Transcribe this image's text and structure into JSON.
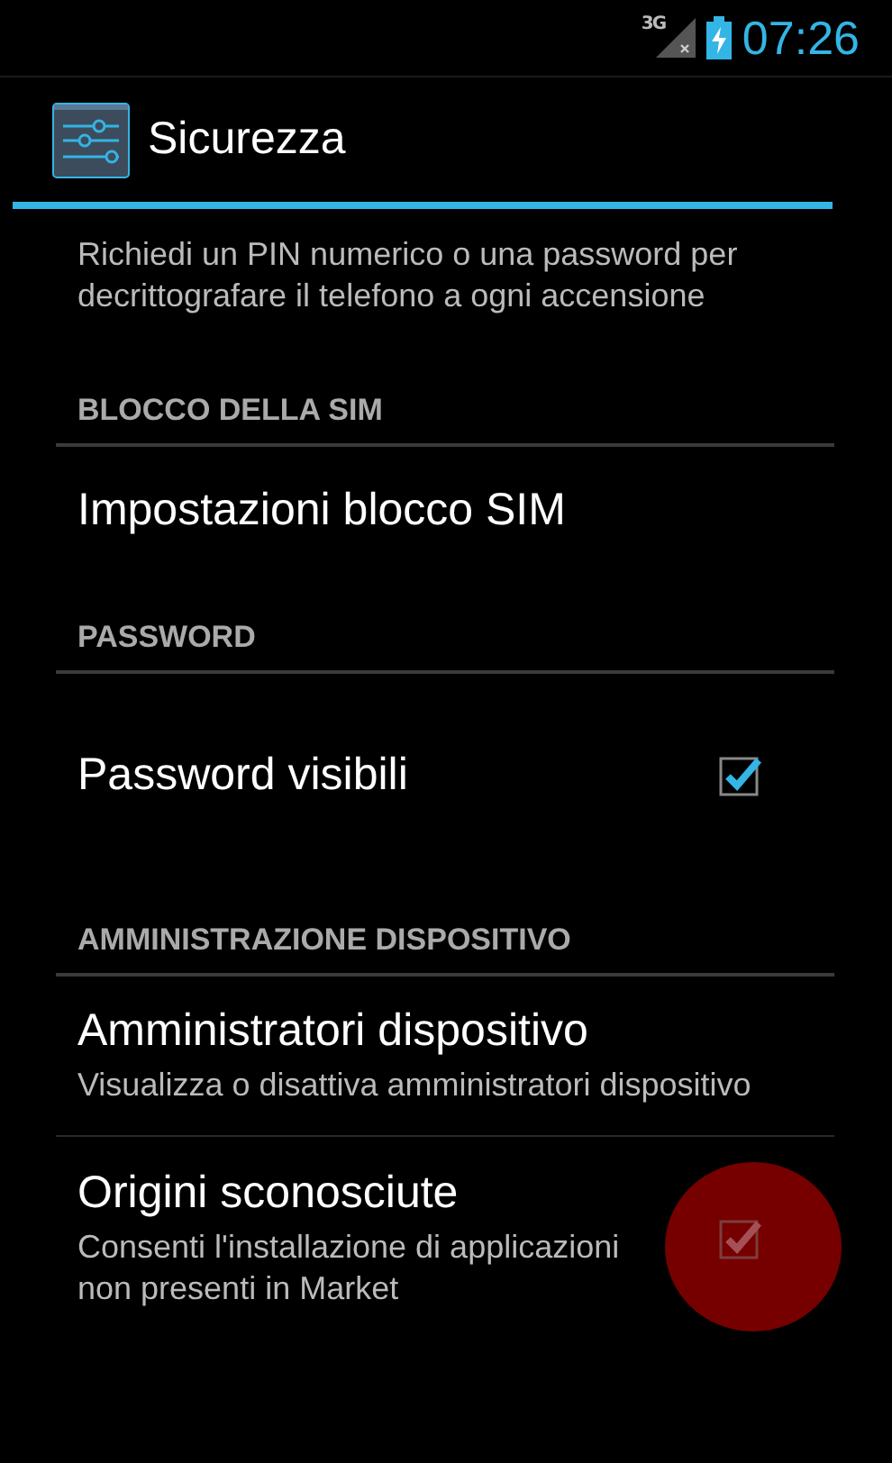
{
  "status_bar": {
    "network": "3G",
    "time": "07:26"
  },
  "action_bar": {
    "title": "Sicurezza"
  },
  "sections": [
    {
      "items": [
        {
          "kind": "plain",
          "summary": "Richiedi un PIN numerico o una password per decrittografare il telefono a ogni accensione"
        }
      ]
    },
    {
      "header": "BLOCCO DELLA SIM",
      "items": [
        {
          "kind": "plain",
          "title": "Impostazioni blocco SIM"
        }
      ]
    },
    {
      "header": "PASSWORD",
      "items": [
        {
          "kind": "checkbox",
          "title": "Password visibili",
          "checked": true
        }
      ]
    },
    {
      "header": "AMMINISTRAZIONE DISPOSITIVO",
      "items": [
        {
          "kind": "plain",
          "title": "Amministratori dispositivo",
          "summary": "Visualizza o disattiva amministratori dispositivo"
        },
        {
          "kind": "checkbox",
          "title": "Origini sconosciute",
          "summary": "Consenti l'installazione di applicazioni non presenti in Market",
          "checked": true,
          "touched": true
        }
      ]
    }
  ]
}
